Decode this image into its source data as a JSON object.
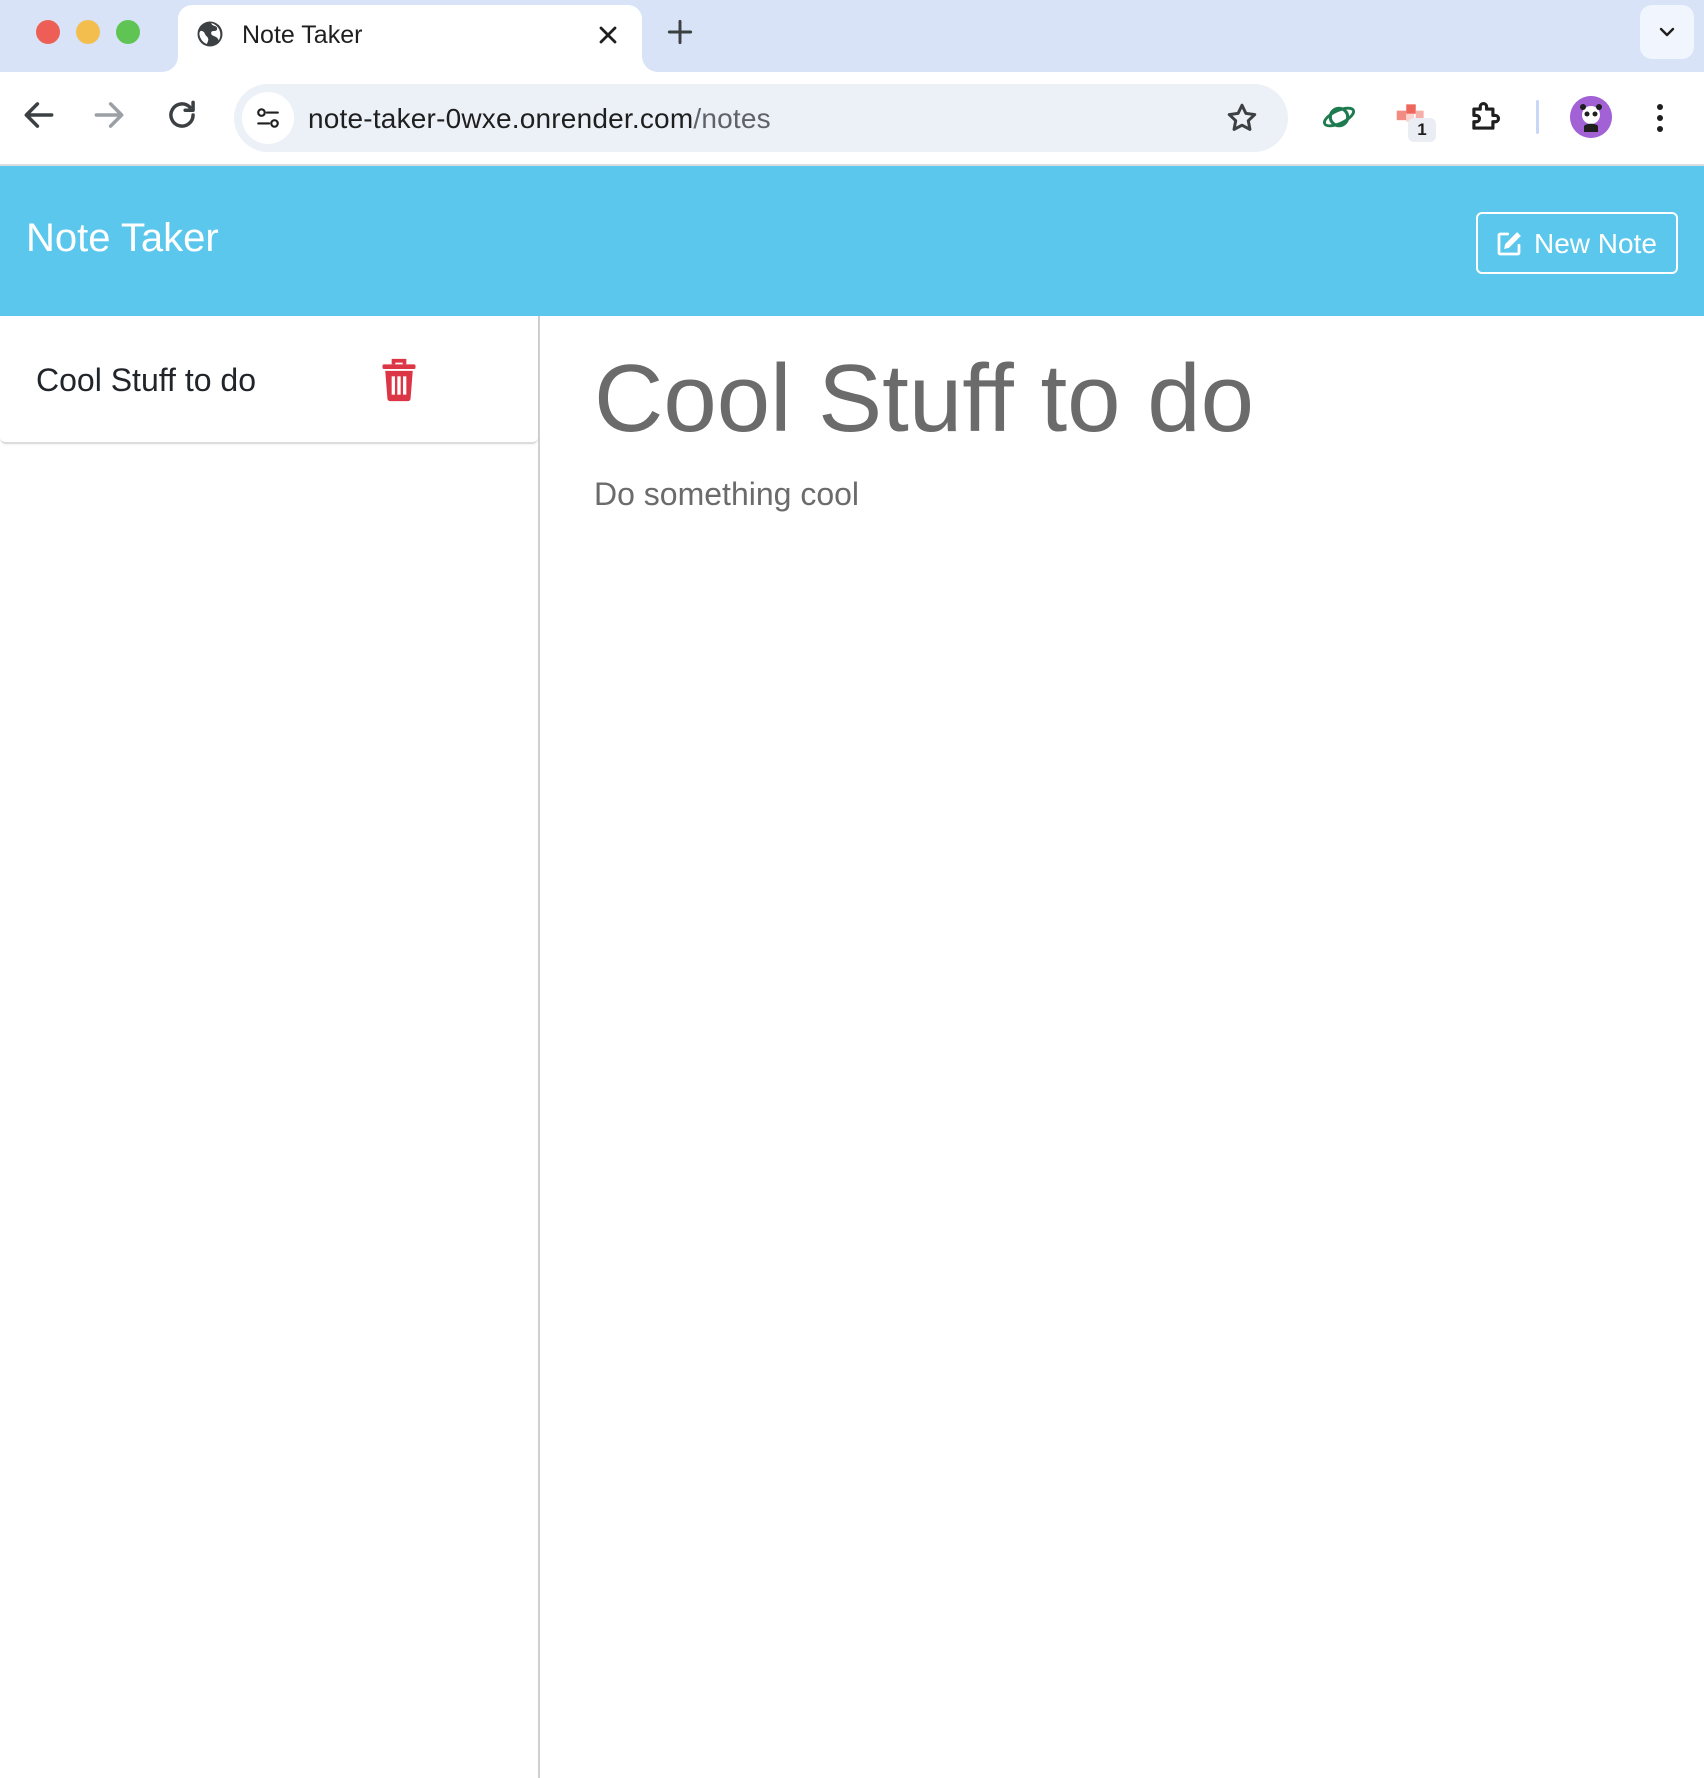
{
  "browser": {
    "tab": {
      "title": "Note Taker",
      "icon": "globe-icon"
    },
    "url": {
      "domain": "note-taker-0wxe.onrender.com",
      "path": "/notes"
    },
    "extension_badge": "1"
  },
  "app": {
    "brand": "Note Taker",
    "new_note_label": "New Note",
    "accent_color": "#5bc7ec",
    "danger_color": "#dc3545"
  },
  "sidebar": {
    "notes": [
      {
        "title": "Cool Stuff to do"
      }
    ]
  },
  "note_view": {
    "title": "Cool Stuff to do",
    "text": "Do something cool"
  }
}
